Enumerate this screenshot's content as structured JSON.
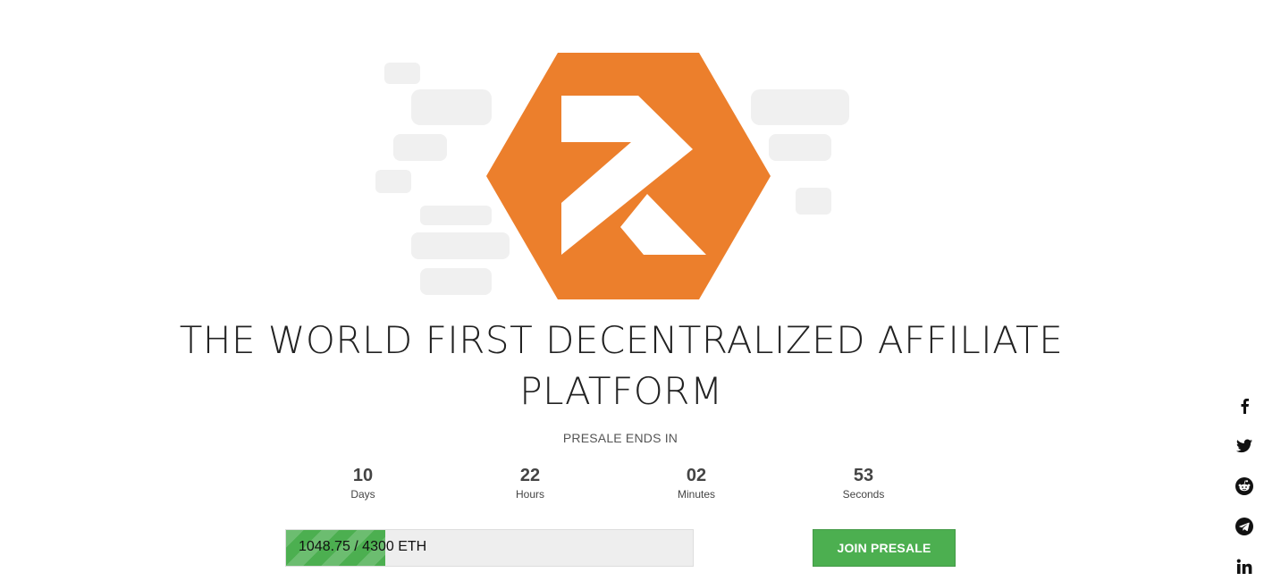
{
  "brand": {
    "logo_color": "#ec7f2c",
    "logo_icon": "z-arrow-logo"
  },
  "hero": {
    "headline_line1": "THE WORLD FIRST DECENTRALIZED AFFILIATE",
    "headline_line2": "PLATFORM",
    "presale_label": "PRESALE ENDS IN"
  },
  "countdown": [
    {
      "value": "10",
      "label": "Days"
    },
    {
      "value": "22",
      "label": "Hours"
    },
    {
      "value": "02",
      "label": "Minutes"
    },
    {
      "value": "53",
      "label": "Seconds"
    }
  ],
  "progress": {
    "text": "1048.75 / 4300 ETH",
    "raised": 1048.75,
    "goal": 4300,
    "fraction": 0.2439,
    "color": "#4caf50"
  },
  "cta": {
    "join_label": "JOIN PRESALE",
    "color": "#4caf50"
  },
  "social": [
    {
      "name": "facebook-icon"
    },
    {
      "name": "twitter-icon"
    },
    {
      "name": "reddit-icon"
    },
    {
      "name": "telegram-icon"
    },
    {
      "name": "linkedin-icon"
    }
  ]
}
